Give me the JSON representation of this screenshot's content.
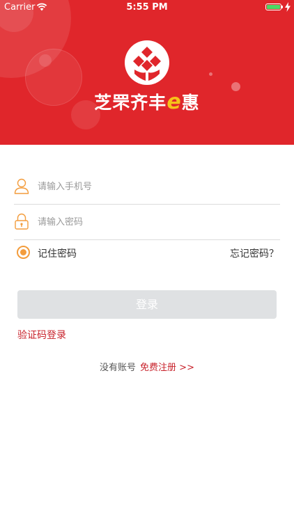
{
  "status_bar": {
    "carrier": "Carrier",
    "time": "5:55 PM"
  },
  "brand": {
    "name_prefix": "芝罘齐丰",
    "name_e": "e",
    "name_suffix": "惠"
  },
  "colors": {
    "header": "#e0262b",
    "accent_orange": "#f39c3c",
    "link_red": "#c8232c",
    "button_disabled": "#dfe1e3",
    "brand_e": "#f6c21a"
  },
  "form": {
    "phone_placeholder": "请输入手机号",
    "phone_icon": "user-icon",
    "password_placeholder": "请输入密码",
    "password_icon": "lock-icon",
    "remember_label": "记住密码",
    "remember_checked": true,
    "forgot_label": "忘记密码？",
    "login_label": "登录",
    "code_login_label": "验证码登录"
  },
  "register": {
    "no_account": "没有账号",
    "register_link": "免费注册 >>"
  }
}
